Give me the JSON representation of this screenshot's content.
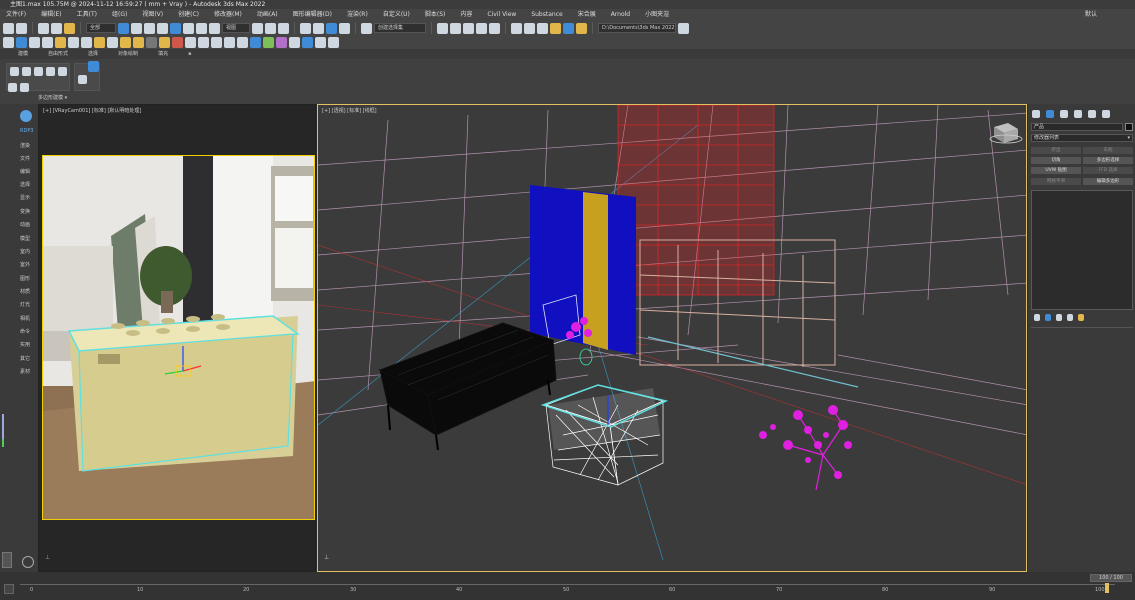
{
  "title": "主图1.max  105.75M @ 2024-11-12 16:59:27  ( mm + Vray )  - Autodesk 3ds Max 2022",
  "menu": [
    "文件(F)",
    "编辑(E)",
    "工具(T)",
    "组(G)",
    "视图(V)",
    "创建(C)",
    "修改器(M)",
    "动画(A)",
    "图形编辑器(D)",
    "渲染(R)",
    "自定义(U)",
    "脚本(S)",
    "内容",
    "Civil View",
    "Substance",
    "宋合展",
    "Arnold",
    "小图夹渲"
  ],
  "workspace_label": "默认",
  "toolbar": {
    "selection_filter": "全部",
    "view_dropdown": "视图",
    "named_selection": "创建选择集",
    "project_path": "D:\\Documents\\3ds Max 2022"
  },
  "ribbon": {
    "tabs": [
      "建模",
      "自由形式",
      "选择",
      "对象绘制",
      "填充"
    ],
    "poly_label": "多边形建模"
  },
  "left_panel": {
    "top_label": "RDP3",
    "items": [
      "渲染",
      "文件",
      "编辑",
      "选择",
      "显示",
      "变换",
      "动画",
      "模型",
      "室内",
      "室外",
      "图形",
      "材质",
      "灯光",
      "相机",
      "命令",
      "实用",
      "其它",
      "素材"
    ]
  },
  "viewport_left": {
    "label": "[+] [VRayCam001] [标准] [默认明暗处理]"
  },
  "viewport_right": {
    "label": "[+] [透视] [标准] [线框]"
  },
  "command_panel": {
    "product_label": "产品",
    "modifier_list": "修改器列表",
    "buttons": [
      "挤出",
      "车削",
      "切角",
      "多边形选择",
      "UVW 贴图",
      "FFD 选择",
      "网格平滑",
      "编辑多边形"
    ]
  },
  "timeline": {
    "frame_display": "100 / 100",
    "ticks": [
      "0",
      "10",
      "20",
      "30",
      "40",
      "50",
      "60",
      "70",
      "80",
      "90",
      "100"
    ]
  },
  "colors": {
    "accent": "#e0c060",
    "bg": "#3b3b3b"
  }
}
